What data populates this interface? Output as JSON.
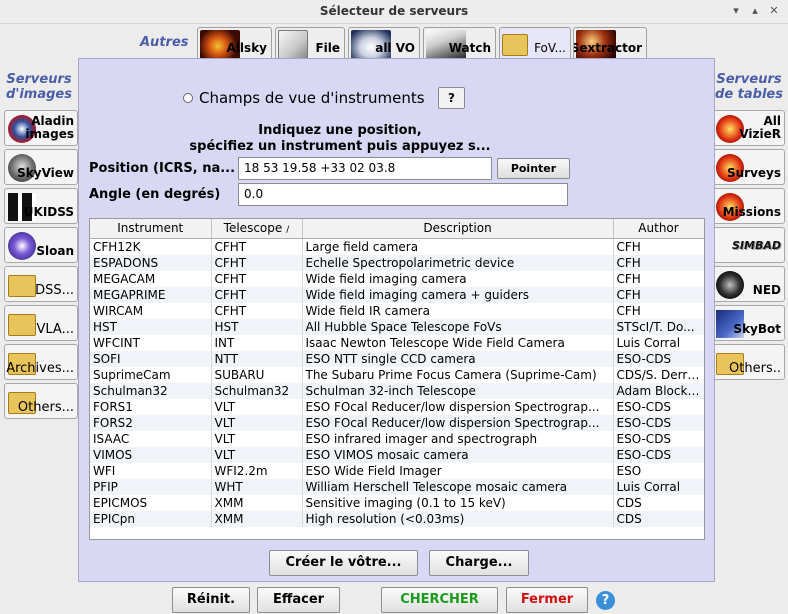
{
  "window": {
    "title": "Sélecteur de serveurs"
  },
  "top": {
    "autres_label": "Autres",
    "tabs": [
      {
        "label": "Allsky",
        "icon": "allsky-icon"
      },
      {
        "label": "File",
        "icon": "file-icon"
      },
      {
        "label": "all VO",
        "icon": "vo-icon"
      },
      {
        "label": "Watch",
        "icon": "telescope-icon"
      },
      {
        "label": "FoV...",
        "icon": "folder-icon"
      },
      {
        "label": "Sextractor",
        "icon": "sextractor-icon"
      }
    ]
  },
  "left": {
    "title_line1": "Serveurs",
    "title_line2": "d'images",
    "items": [
      {
        "label_line1": "Aladin",
        "label_line2": "images",
        "icon": "aladin-icon"
      },
      {
        "label_line1": "SkyView",
        "label_line2": "",
        "icon": "skyview-icon"
      },
      {
        "label_line1": "UKIDSS",
        "label_line2": "",
        "icon": "ukidss-icon"
      },
      {
        "label_line1": "Sloan",
        "label_line2": "",
        "icon": "sloan-icon"
      },
      {
        "label_line1": "DSS...",
        "label_line2": "",
        "icon": "folder-icon"
      },
      {
        "label_line1": "VLA...",
        "label_line2": "",
        "icon": "folder-icon"
      },
      {
        "label_line1": "Archives...",
        "label_line2": "",
        "icon": "folder-icon"
      },
      {
        "label_line1": "Others...",
        "label_line2": "",
        "icon": "folder-icon"
      }
    ]
  },
  "right": {
    "title_line1": "Serveurs",
    "title_line2": "de tables",
    "items": [
      {
        "label_line1": "All",
        "label_line2": "VizieR",
        "icon": "vizier-icon"
      },
      {
        "label_line1": "Surveys",
        "label_line2": "",
        "icon": "surveys-icon"
      },
      {
        "label_line1": "Missions",
        "label_line2": "",
        "icon": "missions-icon"
      },
      {
        "label_line1": "SIMBAD",
        "label_line2": "",
        "icon": "simbad-icon"
      },
      {
        "label_line1": "NED",
        "label_line2": "",
        "icon": "ned-icon"
      },
      {
        "label_line1": "SkyBot",
        "label_line2": "",
        "icon": "skybot-icon"
      },
      {
        "label_line1": "Others..",
        "label_line2": "",
        "icon": "folder-icon"
      }
    ]
  },
  "panel": {
    "mode_label": "Champs de vue d'instruments",
    "help_label": "?",
    "instruction_line1": "Indiquez une position,",
    "instruction_line2": "spécifiez un instrument puis appuyez s...",
    "position_label": "Position (ICRS, na...",
    "position_value": "18 53 19.58 +33 02 03.8",
    "pointer_label": "Pointer",
    "angle_label": "Angle (en degrés)",
    "angle_value": "0.0",
    "create_label": "Créer le vôtre...",
    "load_label": "Charge..."
  },
  "table": {
    "columns": [
      "Instrument",
      "Telescope",
      "Description",
      "Author"
    ],
    "sort_indicator": "/",
    "rows": [
      [
        "CFH12K",
        "CFHT",
        "Large field camera",
        "CFH"
      ],
      [
        "ESPADONS",
        "CFHT",
        "Echelle Spectropolarimetric device",
        "CFH"
      ],
      [
        "MEGACAM",
        "CFHT",
        "Wide field imaging camera",
        "CFH"
      ],
      [
        "MEGAPRIME",
        "CFHT",
        "Wide field imaging camera + guiders",
        "CFH"
      ],
      [
        "WIRCAM",
        "CFHT",
        "Wide field IR camera",
        "CFH"
      ],
      [
        "HST",
        "HST",
        "All Hubble Space Telescope FoVs",
        "STScI/T. Do..."
      ],
      [
        "WFCINT",
        "INT",
        "Isaac Newton Telescope Wide Field Camera",
        "Luis Corral"
      ],
      [
        "SOFI",
        "NTT",
        "ESO NTT single CCD camera",
        "ESO-CDS"
      ],
      [
        "SuprimeCam",
        "SUBARU",
        "The Subaru Prime Focus Camera (Suprime-Cam)",
        "CDS/S. Derri..."
      ],
      [
        "Schulman32",
        "Schulman32",
        "Schulman 32-inch Telescope",
        "Adam Block ..."
      ],
      [
        "FORS1",
        "VLT",
        "ESO FOcal Reducer/low dispersion Spectrograp...",
        "ESO-CDS"
      ],
      [
        "FORS2",
        "VLT",
        "ESO FOcal Reducer/low dispersion Spectrograp...",
        "ESO-CDS"
      ],
      [
        "ISAAC",
        "VLT",
        "ESO infrared imager and spectrograph",
        "ESO-CDS"
      ],
      [
        "VIMOS",
        "VLT",
        "ESO VIMOS mosaic camera",
        "ESO-CDS"
      ],
      [
        "WFI",
        "WFI2.2m",
        "ESO Wide Field Imager",
        "ESO"
      ],
      [
        "PFIP",
        "WHT",
        "William Herschell Telescope mosaic camera",
        "Luis Corral"
      ],
      [
        "EPICMOS",
        "XMM",
        "Sensitive imaging (0.1 to 15 keV)",
        "CDS"
      ],
      [
        "EPICpn",
        "XMM",
        "High resolution (<0.03ms)",
        "CDS"
      ]
    ]
  },
  "bottom": {
    "reset_label": "Réinit.",
    "clear_label": "Effacer",
    "search_label": "CHERCHER",
    "close_label": "Fermer",
    "help_label": "?"
  },
  "colors": {
    "panel_bg": "#d8d8f4",
    "accent_blue": "#4a5ea8",
    "search_green": "#1a9a1a",
    "close_red": "#d01010"
  }
}
